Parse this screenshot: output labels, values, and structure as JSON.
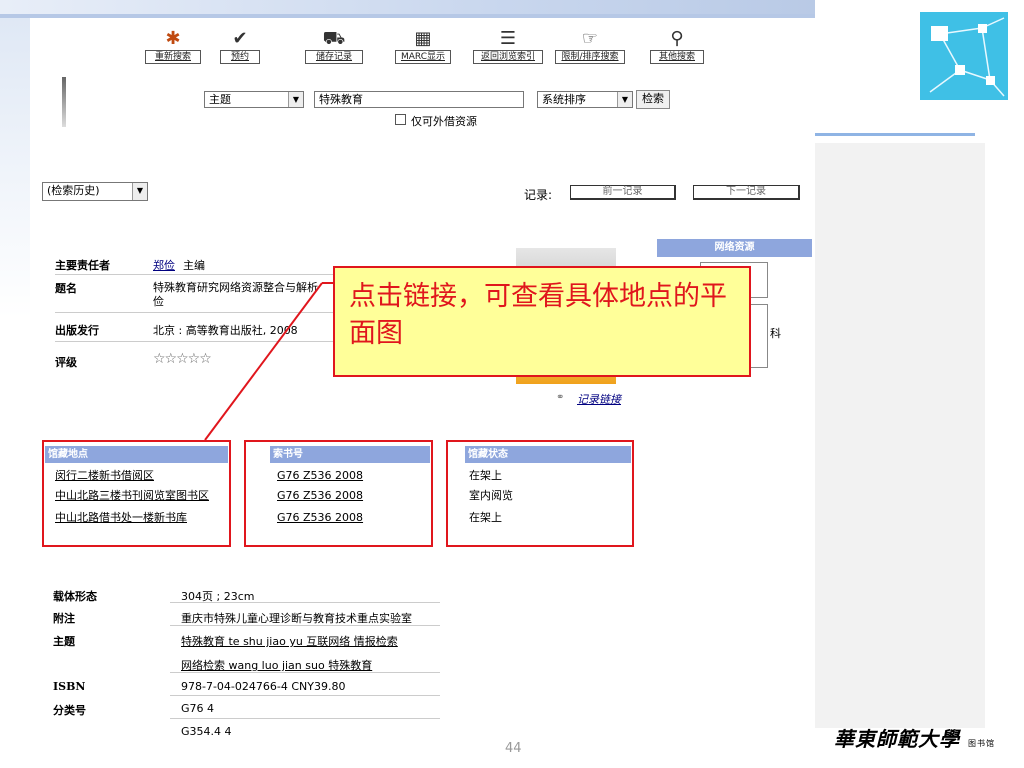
{
  "toolbar": [
    {
      "icon": "sparkle-icon",
      "glyph": "✱",
      "label": "重新搜索"
    },
    {
      "icon": "checkmark-icon",
      "glyph": "✔",
      "label": "预约"
    },
    {
      "icon": "cart-icon",
      "glyph": "⛟",
      "label": "储存记录"
    },
    {
      "icon": "marc-icon",
      "glyph": "▦",
      "label": "MARC显示"
    },
    {
      "icon": "list-icon",
      "glyph": "☰",
      "label": "返回浏览索引"
    },
    {
      "icon": "hand-search-icon",
      "glyph": "☞",
      "label": "限制/排序搜索"
    },
    {
      "icon": "magnifier-icon",
      "glyph": "⚲",
      "label": "其他搜索"
    }
  ],
  "search": {
    "field": "主题",
    "query": "特殊教育",
    "sort": "系统排序",
    "search_button": "检索",
    "loanable_only_label": "仅可外借资源"
  },
  "history": {
    "label": "(检索历史)"
  },
  "record_nav": {
    "label": "记录:",
    "prev": "前一记录",
    "next": "下一记录"
  },
  "detail": {
    "author_label": "主要责任者",
    "author_name": "郑俭",
    "author_role": "主编",
    "title_label": "题名",
    "title_line1": "特殊教育研究网络资源整合与解析",
    "title_line2": "俭",
    "publisher_label": "出版发行",
    "publisher": "北京 : 高等教育出版社, 2008",
    "rating_label": "评级",
    "rating_stars": "☆☆☆☆☆"
  },
  "cover": {
    "record_link": "记录链接"
  },
  "net_resources": {
    "heading": "网络资源",
    "partial_label": "科"
  },
  "holdings": {
    "headers": [
      "馆藏地点",
      "索书号",
      "馆藏状态"
    ],
    "rows": [
      {
        "location": "闵行二楼新书借阅区",
        "call_no": "G76 Z536 2008",
        "status": "在架上"
      },
      {
        "location": "中山北路三楼书刊阅览室图书区",
        "call_no": "G76 Z536 2008",
        "status": "室内阅览"
      },
      {
        "location": "中山北路借书处一楼新书库",
        "call_no": "G76 Z536 2008",
        "status": "在架上"
      }
    ]
  },
  "extra": {
    "format_label": "载体形态",
    "format": "304页 ; 23cm",
    "note_label": "附注",
    "note": "重庆市特殊儿童心理诊断与教育技术重点实验室",
    "subject_label": "主题",
    "subject1": "特殊教育 te shu jiao yu 互联网络 情报检索",
    "subject2": "网络检索 wang luo jian suo 特殊教育",
    "isbn_label": "ISBN",
    "isbn": "978-7-04-024766-4 CNY39.80",
    "class_label": "分类号",
    "class1": "G76 4",
    "class2": "G354.4 4"
  },
  "annotation": "点击链接，可查看具体地点的平面图",
  "slide": {
    "page_number": "44",
    "university_logo": "華東師範大學",
    "logo_suffix": "图书馆"
  },
  "colors": {
    "header_blue": "#8ea6dd",
    "annotation_red": "#e0161d",
    "annotation_fill": "#ffff99"
  }
}
